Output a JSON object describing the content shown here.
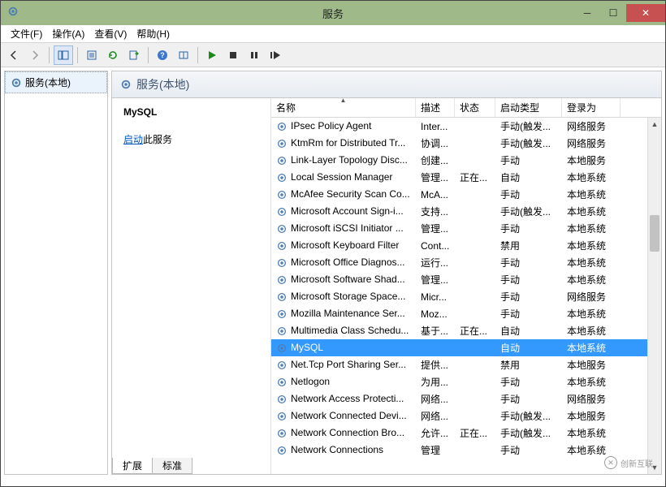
{
  "window": {
    "title": "服务"
  },
  "menu": {
    "file": "文件(F)",
    "action": "操作(A)",
    "view": "查看(V)",
    "help": "帮助(H)"
  },
  "left": {
    "node": "服务(本地)"
  },
  "right": {
    "header": "服务(本地)",
    "detail": {
      "selected_name": "MySQL",
      "start_link": "启动",
      "start_suffix": "此服务"
    },
    "columns": {
      "name": "名称",
      "desc": "描述",
      "status": "状态",
      "startup": "启动类型",
      "logon": "登录为"
    },
    "rows": [
      {
        "name": "IPsec Policy Agent",
        "desc": "Inter...",
        "status": "",
        "startup": "手动(触发...",
        "logon": "网络服务"
      },
      {
        "name": "KtmRm for Distributed Tr...",
        "desc": "协调...",
        "status": "",
        "startup": "手动(触发...",
        "logon": "网络服务"
      },
      {
        "name": "Link-Layer Topology Disc...",
        "desc": "创建...",
        "status": "",
        "startup": "手动",
        "logon": "本地服务"
      },
      {
        "name": "Local Session Manager",
        "desc": "管理...",
        "status": "正在...",
        "startup": "自动",
        "logon": "本地系统"
      },
      {
        "name": "McAfee Security Scan Co...",
        "desc": "McA...",
        "status": "",
        "startup": "手动",
        "logon": "本地系统"
      },
      {
        "name": "Microsoft Account Sign-i...",
        "desc": "支持...",
        "status": "",
        "startup": "手动(触发...",
        "logon": "本地系统"
      },
      {
        "name": "Microsoft iSCSI Initiator ...",
        "desc": "管理...",
        "status": "",
        "startup": "手动",
        "logon": "本地系统"
      },
      {
        "name": "Microsoft Keyboard Filter",
        "desc": "Cont...",
        "status": "",
        "startup": "禁用",
        "logon": "本地系统"
      },
      {
        "name": "Microsoft Office Diagnos...",
        "desc": "运行...",
        "status": "",
        "startup": "手动",
        "logon": "本地系统"
      },
      {
        "name": "Microsoft Software Shad...",
        "desc": "管理...",
        "status": "",
        "startup": "手动",
        "logon": "本地系统"
      },
      {
        "name": "Microsoft Storage Space...",
        "desc": "Micr...",
        "status": "",
        "startup": "手动",
        "logon": "网络服务"
      },
      {
        "name": "Mozilla Maintenance Ser...",
        "desc": "Moz...",
        "status": "",
        "startup": "手动",
        "logon": "本地系统"
      },
      {
        "name": "Multimedia Class Schedu...",
        "desc": "基于...",
        "status": "正在...",
        "startup": "自动",
        "logon": "本地系统"
      },
      {
        "name": "MySQL",
        "desc": "",
        "status": "",
        "startup": "自动",
        "logon": "本地系统",
        "selected": true
      },
      {
        "name": "Net.Tcp Port Sharing Ser...",
        "desc": "提供...",
        "status": "",
        "startup": "禁用",
        "logon": "本地服务"
      },
      {
        "name": "Netlogon",
        "desc": "为用...",
        "status": "",
        "startup": "手动",
        "logon": "本地系统"
      },
      {
        "name": "Network Access Protecti...",
        "desc": "网络...",
        "status": "",
        "startup": "手动",
        "logon": "网络服务"
      },
      {
        "name": "Network Connected Devi...",
        "desc": "网络...",
        "status": "",
        "startup": "手动(触发...",
        "logon": "本地服务"
      },
      {
        "name": "Network Connection Bro...",
        "desc": "允许...",
        "status": "正在...",
        "startup": "手动(触发...",
        "logon": "本地系统"
      },
      {
        "name": "Network Connections",
        "desc": "管理",
        "status": "",
        "startup": "手动",
        "logon": "本地系统"
      }
    ],
    "tabs": {
      "ext": "扩展",
      "std": "标准"
    }
  },
  "watermark": "创新互联"
}
